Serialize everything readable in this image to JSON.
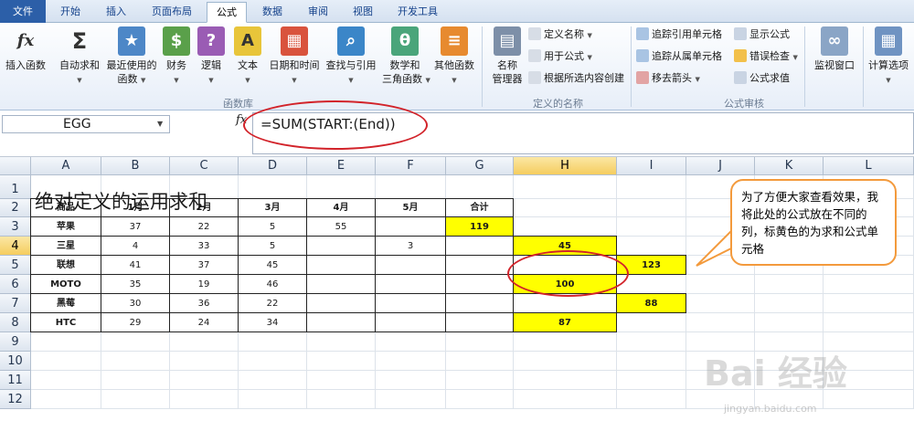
{
  "tabs": [
    "文件",
    "开始",
    "插入",
    "页面布局",
    "公式",
    "数据",
    "审阅",
    "视图",
    "开发工具"
  ],
  "ribbon": {
    "insert_fn": "插入函数",
    "autosum": "自动求和",
    "recent_l1": "最近使用的",
    "recent_l2": "函数",
    "finance": "财务",
    "logic": "逻辑",
    "text": "文本",
    "datetime": "日期和时间",
    "lookup": "查找与引用",
    "math_l1": "数学和",
    "math_l2": "三角函数",
    "other": "其他函数",
    "group_lib": "函数库",
    "name_mgr_l1": "名称",
    "name_mgr_l2": "管理器",
    "define_name": "定义名称",
    "use_in_formula": "用于公式",
    "create_from_sel": "根据所选内容创建",
    "group_names": "定义的名称",
    "trace_prec": "追踪引用单元格",
    "trace_dep": "追踪从属单元格",
    "remove_arrows": "移去箭头",
    "show_formulas": "显示公式",
    "error_check": "错误检查",
    "eval_formula": "公式求值",
    "group_audit": "公式审核",
    "watch": "监视窗口",
    "calc_opts": "计算选项"
  },
  "namebox": "EGG",
  "fx_label": "fx",
  "formula": "=SUM(START:(End))",
  "columns": [
    "A",
    "B",
    "C",
    "D",
    "E",
    "F",
    "G",
    "H",
    "I",
    "J",
    "K",
    "L"
  ],
  "rows": [
    "1",
    "2",
    "3",
    "4",
    "5",
    "6",
    "7",
    "8",
    "9",
    "10",
    "11",
    "12"
  ],
  "title": "绝对定义的运用求和",
  "table": {
    "headers": [
      "商品",
      "1月",
      "2月",
      "3月",
      "4月",
      "5月",
      "合计"
    ],
    "r3": [
      "苹果",
      "37",
      "22",
      "5",
      "55",
      "",
      "119"
    ],
    "r4": [
      "三星",
      "4",
      "33",
      "5",
      "",
      "3",
      ""
    ],
    "r5": [
      "联想",
      "41",
      "37",
      "45",
      "",
      "",
      ""
    ],
    "r6": [
      "MOTO",
      "35",
      "19",
      "46",
      "",
      "",
      ""
    ],
    "r7": [
      "黑莓",
      "30",
      "36",
      "22",
      "",
      "",
      ""
    ],
    "r8": [
      "HTC",
      "29",
      "24",
      "34",
      "",
      "",
      ""
    ]
  },
  "sums": {
    "h4": "45",
    "i5": "123",
    "h6": "100",
    "i7": "88",
    "h8": "87"
  },
  "callout": "为了方便大家查看效果，我将此处的公式放在不同的列，标黄色的为求和公式单元格",
  "watermark": "Bai 经验",
  "watermark_url": "jingyan.baidu.com",
  "colors": {
    "highlight": "#ffff00",
    "annotation": "#d2232a",
    "callout_border": "#f39a3c",
    "file_tab": "#2c5fa8"
  }
}
